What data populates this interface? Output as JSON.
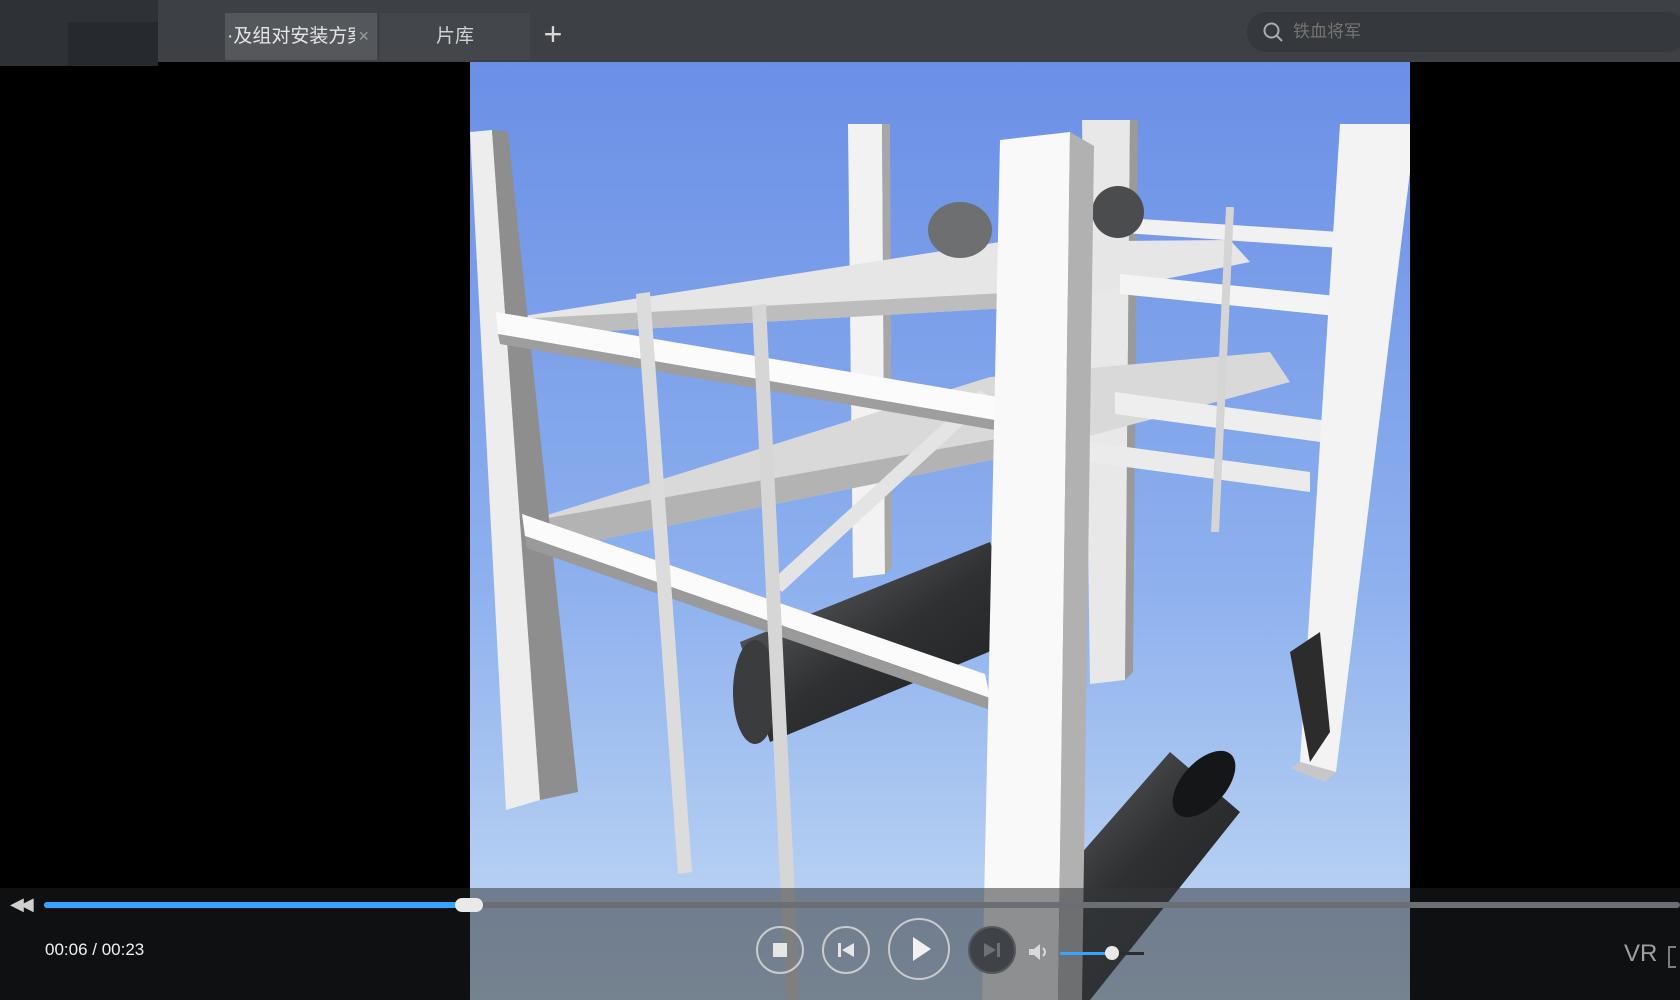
{
  "tabs": [
    {
      "label": "·及组对安装方案",
      "active": true
    },
    {
      "label": "片库",
      "active": false
    }
  ],
  "tab_close_symbol": "×",
  "tab_add_symbol": "+",
  "search": {
    "placeholder": "铁血将军"
  },
  "player": {
    "time_text": "00:06 / 00:23",
    "progress_fraction": 0.26,
    "volume_fraction": 0.62,
    "vr_label": "VR",
    "rewind_symbol": "◀◀"
  },
  "icons": {
    "search": "search-icon",
    "stop": "stop-icon",
    "previous": "skip-previous-icon",
    "play": "play-icon",
    "next": "skip-next-icon",
    "volume": "volume-icon"
  },
  "colors": {
    "accent": "#35a3ff",
    "sky_top": "#6b8fe6",
    "sky_bottom": "#c4dbf4"
  }
}
